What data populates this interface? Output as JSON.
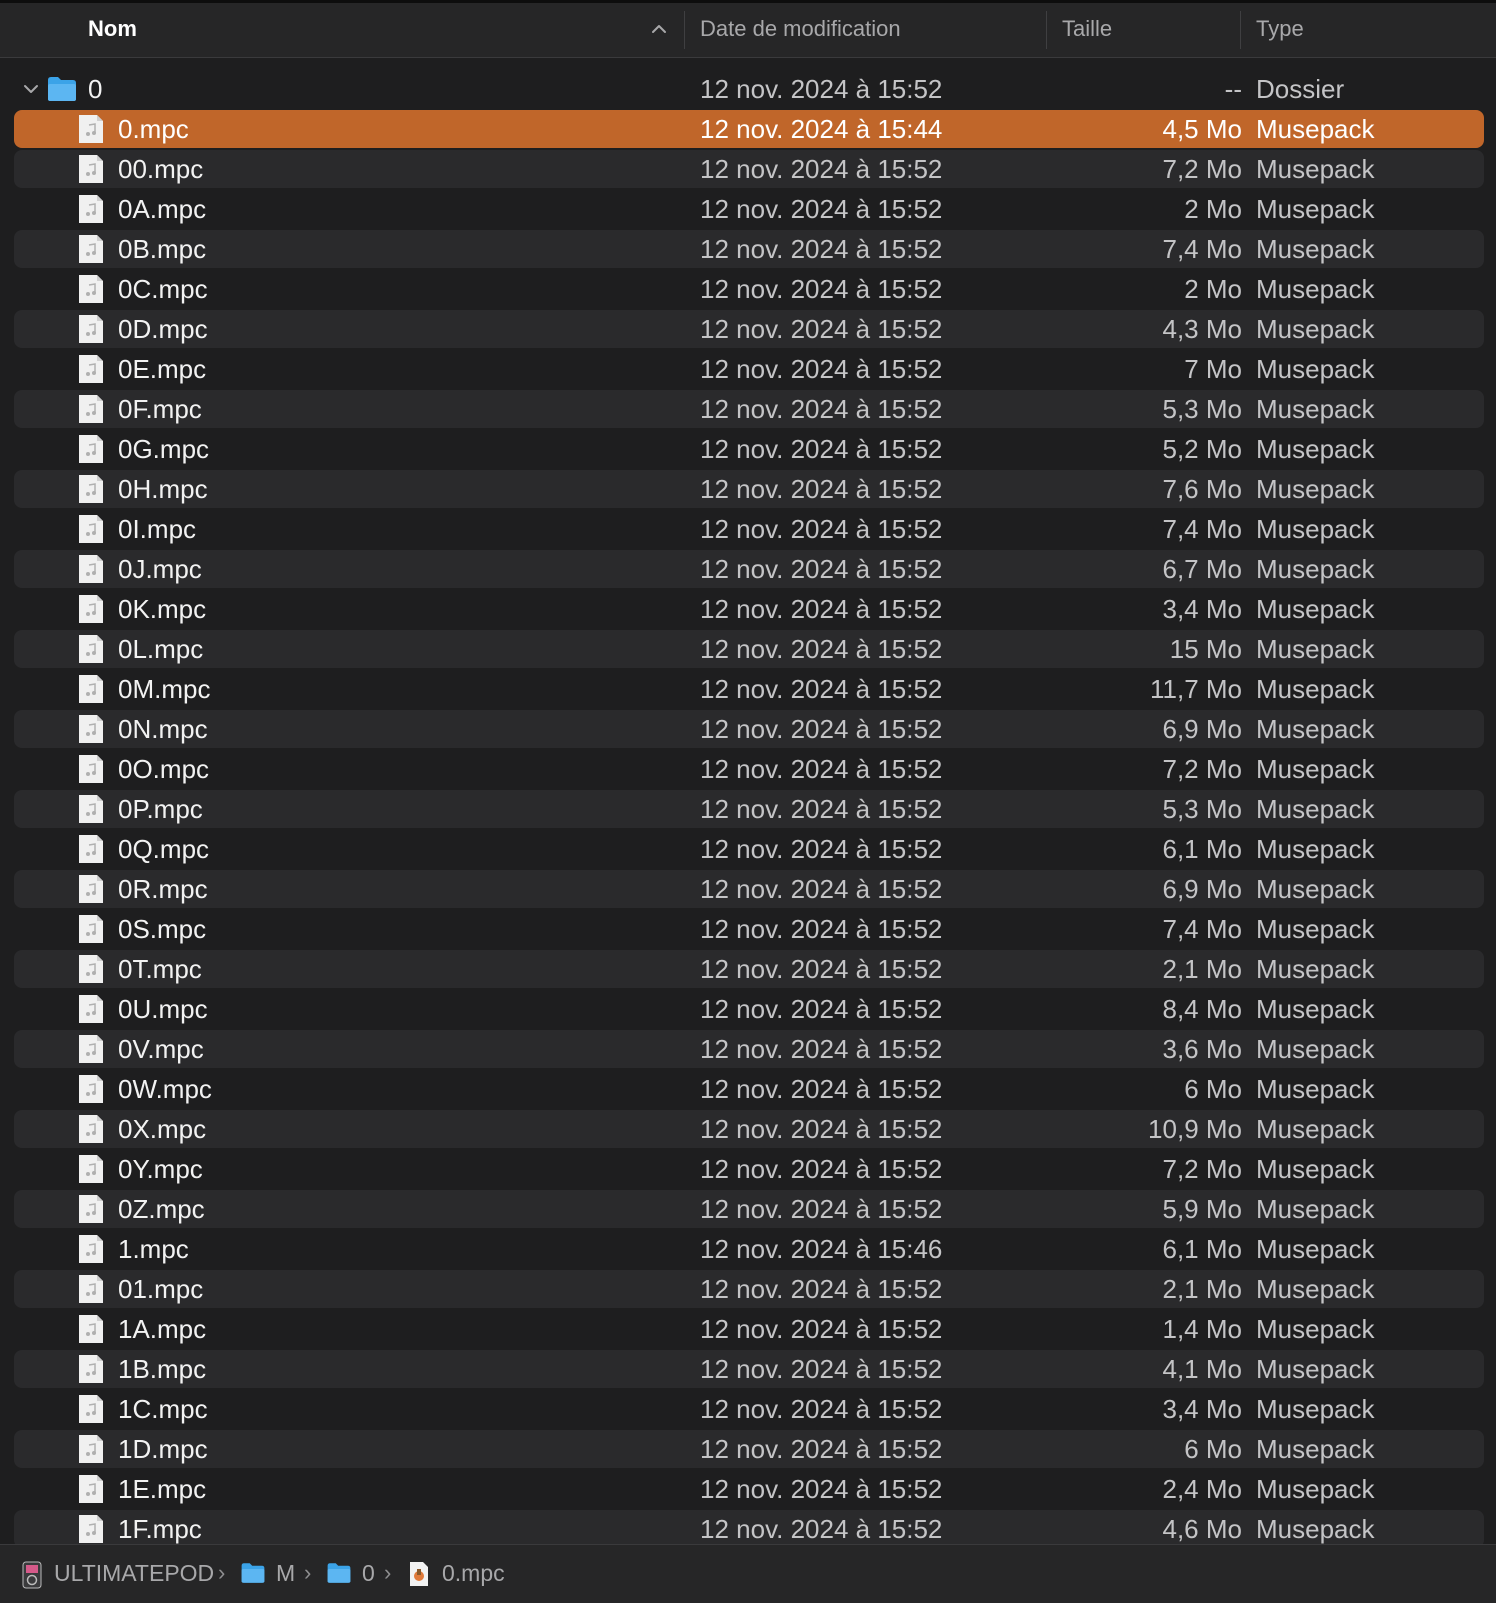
{
  "header": {
    "name": "Nom",
    "date": "Date de modification",
    "size": "Taille",
    "type": "Type"
  },
  "folder": {
    "name": "0",
    "date": "12 nov. 2024 à 15:52",
    "size": "--",
    "type": "Dossier"
  },
  "files": [
    {
      "name": "0.mpc",
      "date": "12 nov. 2024 à 15:44",
      "size": "4,5 Mo",
      "type": "Musepack",
      "selected": true
    },
    {
      "name": "00.mpc",
      "date": "12 nov. 2024 à 15:52",
      "size": "7,2 Mo",
      "type": "Musepack"
    },
    {
      "name": "0A.mpc",
      "date": "12 nov. 2024 à 15:52",
      "size": "2 Mo",
      "type": "Musepack"
    },
    {
      "name": "0B.mpc",
      "date": "12 nov. 2024 à 15:52",
      "size": "7,4 Mo",
      "type": "Musepack"
    },
    {
      "name": "0C.mpc",
      "date": "12 nov. 2024 à 15:52",
      "size": "2 Mo",
      "type": "Musepack"
    },
    {
      "name": "0D.mpc",
      "date": "12 nov. 2024 à 15:52",
      "size": "4,3 Mo",
      "type": "Musepack"
    },
    {
      "name": "0E.mpc",
      "date": "12 nov. 2024 à 15:52",
      "size": "7 Mo",
      "type": "Musepack"
    },
    {
      "name": "0F.mpc",
      "date": "12 nov. 2024 à 15:52",
      "size": "5,3 Mo",
      "type": "Musepack"
    },
    {
      "name": "0G.mpc",
      "date": "12 nov. 2024 à 15:52",
      "size": "5,2 Mo",
      "type": "Musepack"
    },
    {
      "name": "0H.mpc",
      "date": "12 nov. 2024 à 15:52",
      "size": "7,6 Mo",
      "type": "Musepack"
    },
    {
      "name": "0I.mpc",
      "date": "12 nov. 2024 à 15:52",
      "size": "7,4 Mo",
      "type": "Musepack"
    },
    {
      "name": "0J.mpc",
      "date": "12 nov. 2024 à 15:52",
      "size": "6,7 Mo",
      "type": "Musepack"
    },
    {
      "name": "0K.mpc",
      "date": "12 nov. 2024 à 15:52",
      "size": "3,4 Mo",
      "type": "Musepack"
    },
    {
      "name": "0L.mpc",
      "date": "12 nov. 2024 à 15:52",
      "size": "15 Mo",
      "type": "Musepack"
    },
    {
      "name": "0M.mpc",
      "date": "12 nov. 2024 à 15:52",
      "size": "11,7 Mo",
      "type": "Musepack"
    },
    {
      "name": "0N.mpc",
      "date": "12 nov. 2024 à 15:52",
      "size": "6,9 Mo",
      "type": "Musepack"
    },
    {
      "name": "0O.mpc",
      "date": "12 nov. 2024 à 15:52",
      "size": "7,2 Mo",
      "type": "Musepack"
    },
    {
      "name": "0P.mpc",
      "date": "12 nov. 2024 à 15:52",
      "size": "5,3 Mo",
      "type": "Musepack"
    },
    {
      "name": "0Q.mpc",
      "date": "12 nov. 2024 à 15:52",
      "size": "6,1 Mo",
      "type": "Musepack"
    },
    {
      "name": "0R.mpc",
      "date": "12 nov. 2024 à 15:52",
      "size": "6,9 Mo",
      "type": "Musepack"
    },
    {
      "name": "0S.mpc",
      "date": "12 nov. 2024 à 15:52",
      "size": "7,4 Mo",
      "type": "Musepack"
    },
    {
      "name": "0T.mpc",
      "date": "12 nov. 2024 à 15:52",
      "size": "2,1 Mo",
      "type": "Musepack"
    },
    {
      "name": "0U.mpc",
      "date": "12 nov. 2024 à 15:52",
      "size": "8,4 Mo",
      "type": "Musepack"
    },
    {
      "name": "0V.mpc",
      "date": "12 nov. 2024 à 15:52",
      "size": "3,6 Mo",
      "type": "Musepack"
    },
    {
      "name": "0W.mpc",
      "date": "12 nov. 2024 à 15:52",
      "size": "6 Mo",
      "type": "Musepack"
    },
    {
      "name": "0X.mpc",
      "date": "12 nov. 2024 à 15:52",
      "size": "10,9 Mo",
      "type": "Musepack"
    },
    {
      "name": "0Y.mpc",
      "date": "12 nov. 2024 à 15:52",
      "size": "7,2 Mo",
      "type": "Musepack"
    },
    {
      "name": "0Z.mpc",
      "date": "12 nov. 2024 à 15:52",
      "size": "5,9 Mo",
      "type": "Musepack"
    },
    {
      "name": "1.mpc",
      "date": "12 nov. 2024 à 15:46",
      "size": "6,1 Mo",
      "type": "Musepack"
    },
    {
      "name": "01.mpc",
      "date": "12 nov. 2024 à 15:52",
      "size": "2,1 Mo",
      "type": "Musepack"
    },
    {
      "name": "1A.mpc",
      "date": "12 nov. 2024 à 15:52",
      "size": "1,4 Mo",
      "type": "Musepack"
    },
    {
      "name": "1B.mpc",
      "date": "12 nov. 2024 à 15:52",
      "size": "4,1 Mo",
      "type": "Musepack"
    },
    {
      "name": "1C.mpc",
      "date": "12 nov. 2024 à 15:52",
      "size": "3,4 Mo",
      "type": "Musepack"
    },
    {
      "name": "1D.mpc",
      "date": "12 nov. 2024 à 15:52",
      "size": "6 Mo",
      "type": "Musepack"
    },
    {
      "name": "1E.mpc",
      "date": "12 nov. 2024 à 15:52",
      "size": "2,4 Mo",
      "type": "Musepack"
    },
    {
      "name": "1F.mpc",
      "date": "12 nov. 2024 à 15:52",
      "size": "4,6 Mo",
      "type": "Musepack"
    }
  ],
  "pathbar": {
    "items": [
      "ULTIMATEPOD",
      "M",
      "0",
      "0.mpc"
    ],
    "separator": "›"
  },
  "colors": {
    "selection": "#c0662a",
    "folder": "#3ba3e8",
    "background": "#1e1e1f"
  }
}
